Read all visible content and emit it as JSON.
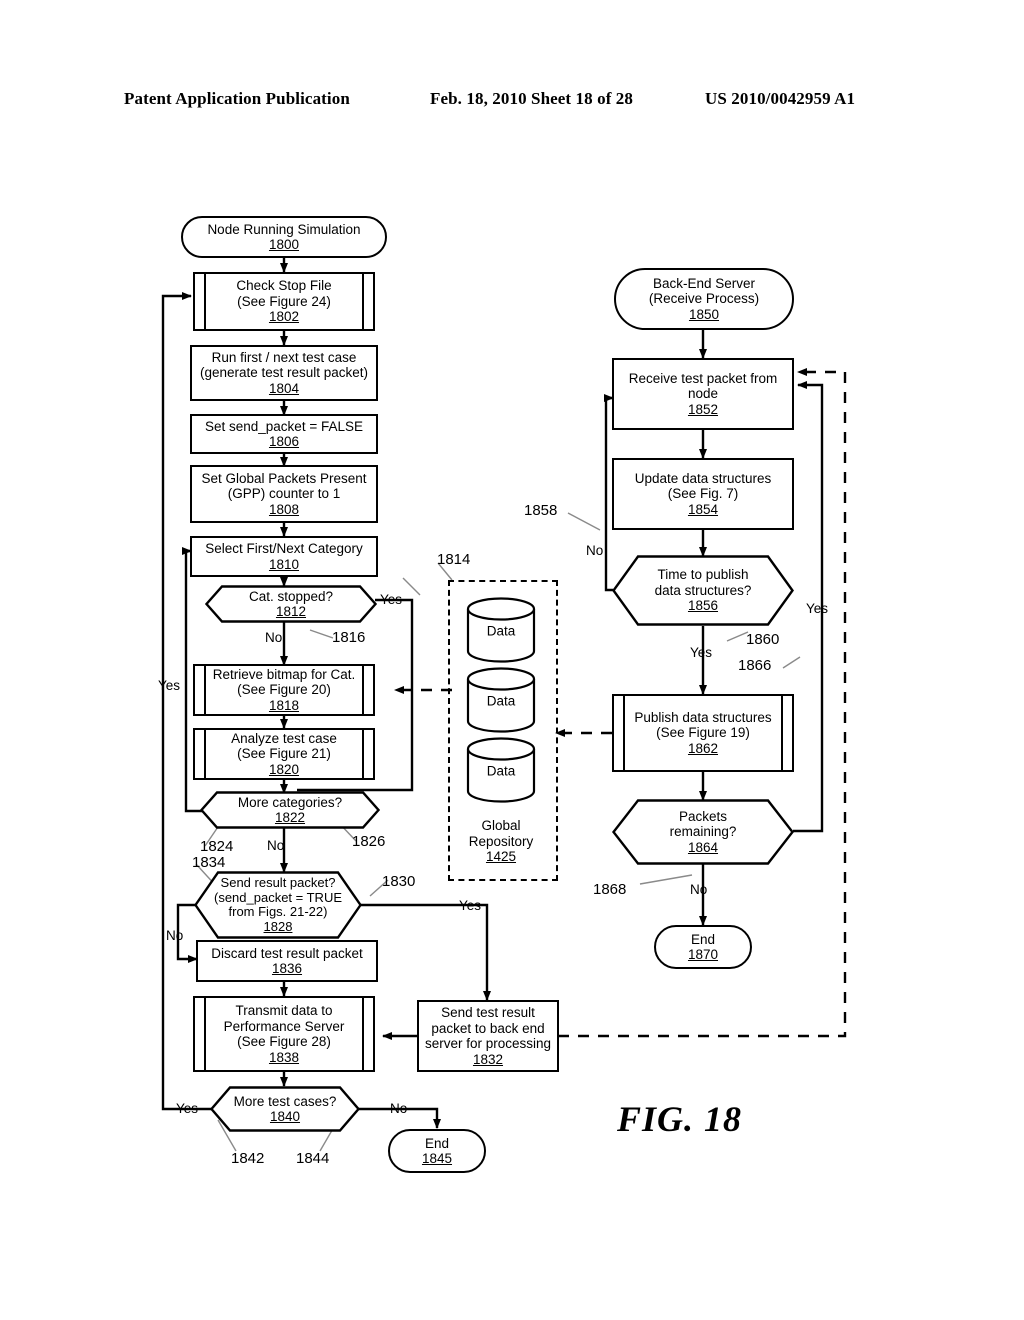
{
  "header": {
    "publication": "Patent Application Publication",
    "date_sheet": "Feb. 18, 2010  Sheet 18 of 28",
    "patent_number": "US 2010/0042959 A1"
  },
  "figure": {
    "caption": "FIG. 18"
  },
  "nodes": {
    "n1800": {
      "text": "Node Running Simulation",
      "ref": "1800",
      "shape": "terminator"
    },
    "n1802": {
      "text": "Check Stop File\n(See Figure 24)",
      "ref": "1802",
      "shape": "predefined-process"
    },
    "n1804": {
      "text": "Run first / next test case\n(generate test result packet)",
      "ref": "1804",
      "shape": "process"
    },
    "n1806": {
      "text": "Set send_packet = FALSE",
      "ref": "1806",
      "shape": "process"
    },
    "n1808": {
      "text": "Set Global Packets Present\n(GPP) counter to 1",
      "ref": "1808",
      "shape": "process"
    },
    "n1810": {
      "text": "Select First/Next Category",
      "ref": "1810",
      "shape": "process"
    },
    "n1812": {
      "text": "Cat. stopped?",
      "ref": "1812",
      "shape": "decision"
    },
    "n1818": {
      "text": "Retrieve bitmap for Cat.\n(See Figure 20)",
      "ref": "1818",
      "shape": "predefined-process"
    },
    "n1820": {
      "text": "Analyze test case\n(See Figure 21)",
      "ref": "1820",
      "shape": "predefined-process"
    },
    "n1822": {
      "text": "More categories?",
      "ref": "1822",
      "shape": "decision"
    },
    "n1828": {
      "text": "Send result packet?\n(send_packet = TRUE\nfrom Figs. 21-22)",
      "ref": "1828",
      "shape": "decision"
    },
    "n1832": {
      "text": "Send test result\npacket to back end\nserver for processing",
      "ref": "1832",
      "shape": "process"
    },
    "n1836": {
      "text": "Discard test result packet",
      "ref": "1836",
      "shape": "process"
    },
    "n1838": {
      "text": "Transmit data to\nPerformance Server\n(See Figure 28)",
      "ref": "1838",
      "shape": "predefined-process"
    },
    "n1840": {
      "text": "More test cases?",
      "ref": "1840",
      "shape": "decision"
    },
    "n1845": {
      "text": "End",
      "ref": "1845",
      "shape": "terminator"
    },
    "n1850": {
      "text": "Back-End Server\n(Receive Process)",
      "ref": "1850",
      "shape": "terminator"
    },
    "n1852": {
      "text": "Receive test packet from\nnode",
      "ref": "1852",
      "shape": "process"
    },
    "n1854": {
      "text": "Update data structures\n(See Fig. 7)",
      "ref": "1854",
      "shape": "process"
    },
    "n1856": {
      "text": "Time to publish\ndata structures?",
      "ref": "1856",
      "shape": "decision"
    },
    "n1862": {
      "text": "Publish data structures\n(See Figure 19)",
      "ref": "1862",
      "shape": "predefined-process"
    },
    "n1864": {
      "text": "Packets\nremaining?",
      "ref": "1864",
      "shape": "decision"
    },
    "n1870": {
      "text": "End",
      "ref": "1870",
      "shape": "terminator"
    }
  },
  "repository": {
    "title_line1": "Global",
    "title_line2": "Repository",
    "ref": "1425",
    "disks": [
      {
        "label": "Data"
      },
      {
        "label": "Data"
      },
      {
        "label": "Data"
      }
    ]
  },
  "edge_labels": {
    "e1812_yes": "Yes",
    "e1812_no": "No",
    "e1822_yes": "Yes",
    "e1822_no": "No",
    "e1828_yes": "Yes",
    "e1828_no": "No",
    "e1840_yes": "Yes",
    "e1840_no": "No",
    "e1856_no": "No",
    "e1856_yes": "Yes",
    "e1864_yes": "Yes",
    "e1864_no": "No"
  },
  "ref_numerals": {
    "r1814": "1814",
    "r1816": "1816",
    "r1824": "1824",
    "r1826": "1826",
    "r1830": "1830",
    "r1834": "1834",
    "r1842": "1842",
    "r1844": "1844",
    "r1858": "1858",
    "r1860": "1860",
    "r1866": "1866",
    "r1868": "1868"
  },
  "colors": {
    "ink": "#000000",
    "paper": "#ffffff"
  }
}
